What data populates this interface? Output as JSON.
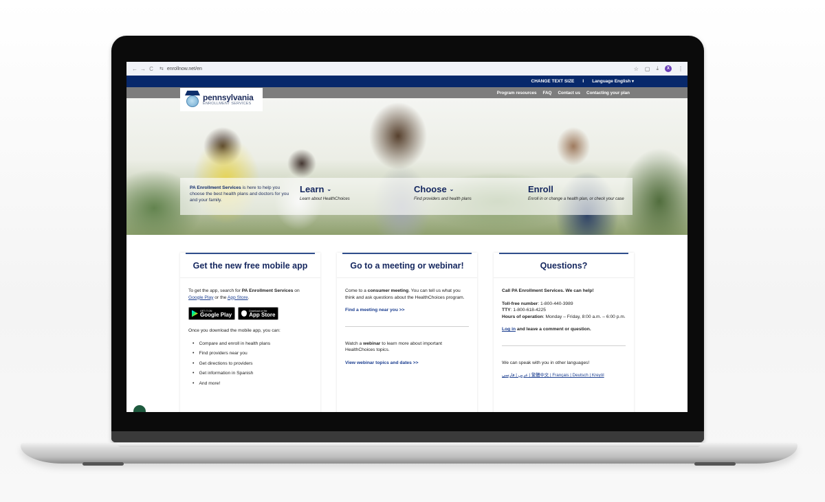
{
  "browser": {
    "url": "enrollnow.net/en",
    "back_icon": "←",
    "forward_icon": "→",
    "reload_icon": "C",
    "site_settings_icon": "⇆",
    "bookmark_icon": "☆",
    "extensions_icon": "▢",
    "download_icon": "⤓",
    "profile_initial": "X",
    "menu_icon": "⋮"
  },
  "utility_bar": {
    "change_text_size": "CHANGE TEXT SIZE",
    "separator": "I",
    "language_label": "Language English",
    "language_chevron": "▾"
  },
  "secondary_nav": {
    "items": [
      "Program resources",
      "FAQ",
      "Contact us",
      "Contacting your plan"
    ]
  },
  "logo": {
    "name": "pennsylvania",
    "subtitle": "ENROLLMENT SERVICES"
  },
  "hero": {
    "intro_bold": "PA Enrollment Services",
    "intro_rest": " is here to help you choose the best health plans and doctors for you and your family.",
    "columns": [
      {
        "title": "Learn",
        "chevron": "⌄",
        "description": "Learn about HealthChoices"
      },
      {
        "title": "Choose",
        "chevron": "⌄",
        "description": "Find providers and health plans"
      },
      {
        "title": "Enroll",
        "chevron": "",
        "description": "Enroll in or change a health plan, or check your case"
      }
    ]
  },
  "cards": {
    "app": {
      "title": "Get the new free mobile app",
      "intro_pre": "To get the app, search for ",
      "intro_bold": "PA Enrollment Services",
      "intro_on": " on ",
      "google_play_link": "Google Play",
      "intro_or": " or the ",
      "app_store_link": "App Store",
      "intro_end": ".",
      "google_badge_small": "GET IT ON",
      "google_badge_big": "Google Play",
      "apple_badge_small": "Download on the",
      "apple_badge_big": "App Store",
      "list_intro": "Once you download the mobile app, you can:",
      "features": [
        "Compare and enroll in health plans",
        "Find providers near you",
        "Get directions to providers",
        "Get information in Spanish",
        "And more!"
      ]
    },
    "meeting": {
      "title": "Go to a meeting or webinar!",
      "meeting_pre": "Come to a ",
      "meeting_bold": "consumer meeting",
      "meeting_rest": ". You can tell us what you think and ask questions about the HealthChoices program.",
      "meeting_link": "Find a meeting near you >>",
      "webinar_pre": "Watch a ",
      "webinar_bold": "webinar",
      "webinar_rest": " to learn more about important HealthChoices topics.",
      "webinar_link": "View webinar topics and dates >>"
    },
    "questions": {
      "title": "Questions?",
      "call_line": "Call PA Enrollment Services. We can help!",
      "tollfree_label": "Toll-free number",
      "tollfree_value": ": 1-800-440-3989",
      "tty_label": "TTY",
      "tty_value": ": 1-800-618-4225",
      "hours_label": "Hours of operation",
      "hours_value": ": Monday – Friday, 8:00 a.m. – 6:00 p.m.",
      "login_link": "Log in",
      "login_rest": " and leave a comment or question.",
      "languages_intro": "We can speak with you in other languages!",
      "languages_links": "عربي | فارسی | 繁體中文 | Français | Deutsch | Kreyòl"
    }
  }
}
